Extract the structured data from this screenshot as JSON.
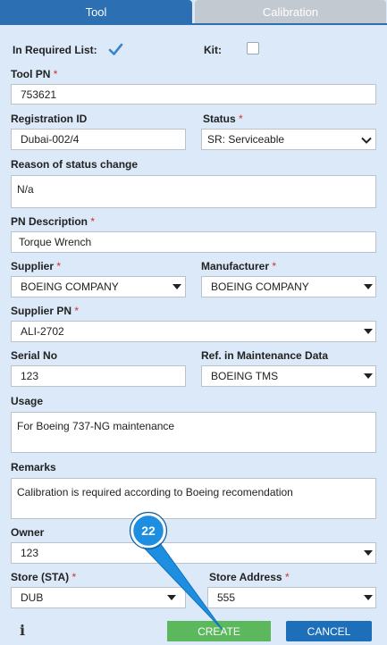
{
  "tabs": {
    "tool": "Tool",
    "calibration": "Calibration"
  },
  "form": {
    "in_required_list": {
      "label": "In Required List:",
      "checked": true
    },
    "kit": {
      "label": "Kit:",
      "checked": false
    },
    "tool_pn": {
      "label": "Tool PN",
      "required": "*",
      "value": "753621"
    },
    "registration_id": {
      "label": "Registration ID",
      "value": "Dubai-002/4"
    },
    "status": {
      "label": "Status",
      "required": "*",
      "value": "SR: Serviceable"
    },
    "reason": {
      "label": "Reason of status change",
      "value": "N/a"
    },
    "pn_description": {
      "label": "PN Description",
      "required": "*",
      "value": "Torque Wrench"
    },
    "supplier": {
      "label": "Supplier",
      "required": "*",
      "value": "BOEING COMPANY"
    },
    "manufacturer": {
      "label": "Manufacturer",
      "required": "*",
      "value": "BOEING COMPANY"
    },
    "supplier_pn": {
      "label": "Supplier PN",
      "required": "*",
      "value": "ALI-2702"
    },
    "serial_no": {
      "label": "Serial No",
      "value": "123"
    },
    "ref_maintenance": {
      "label": "Ref. in Maintenance Data",
      "value": "BOEING TMS"
    },
    "usage": {
      "label": "Usage",
      "value": "For Boeing 737-NG maintenance"
    },
    "remarks": {
      "label": "Remarks",
      "value": "Calibration is required according to Boeing recomendation"
    },
    "owner": {
      "label": "Owner",
      "value": "123"
    },
    "store_sta": {
      "label": "Store (STA)",
      "required": "*",
      "value": "DUB"
    },
    "store_address": {
      "label": "Store Address",
      "required": "*",
      "value": "555"
    }
  },
  "footer": {
    "info_icon": "i",
    "create_label": "CREATE",
    "cancel_label": "CANCEL"
  },
  "step_marker": {
    "number": "22"
  },
  "colors": {
    "tab_active": "#2c6fb2",
    "create": "#5cb85c",
    "cancel": "#1d6fba",
    "marker": "#1e8fe0"
  }
}
